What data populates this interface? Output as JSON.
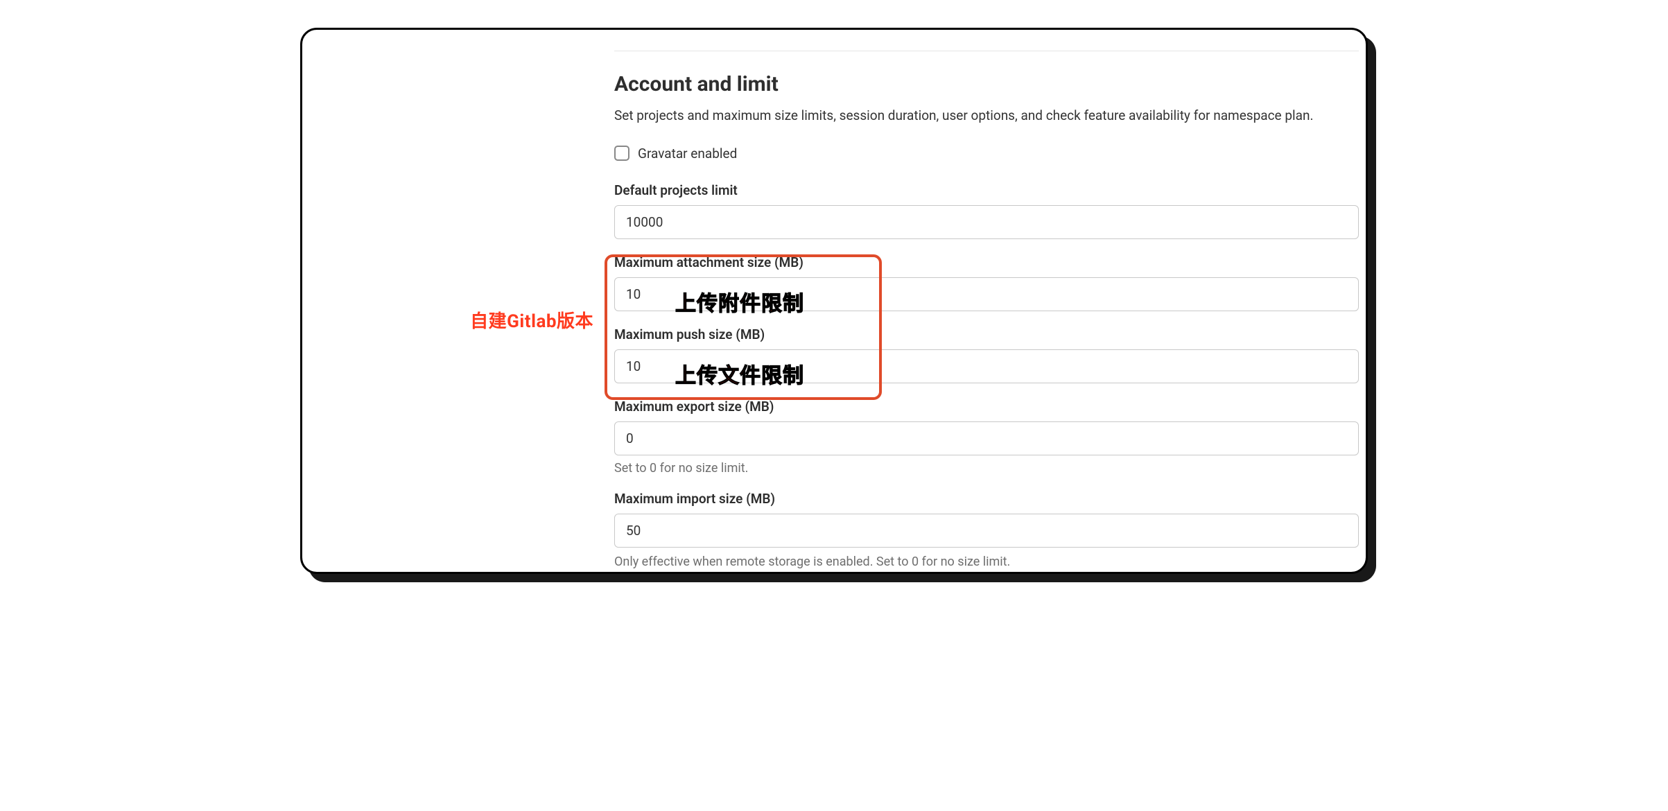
{
  "annotations": {
    "side_label": "自建Gitlab版本",
    "overlay_attachment": "上传附件限制",
    "overlay_push": "上传文件限制"
  },
  "section": {
    "title": "Account and limit",
    "description": "Set projects and maximum size limits, session duration, user options, and check feature availability for namespace plan."
  },
  "gravatar": {
    "label": "Gravatar enabled",
    "checked": false
  },
  "fields": {
    "default_projects_limit": {
      "label": "Default projects limit",
      "value": "10000"
    },
    "max_attachment_size": {
      "label": "Maximum attachment size (MB)",
      "value": "10"
    },
    "max_push_size": {
      "label": "Maximum push size (MB)",
      "value": "10"
    },
    "max_export_size": {
      "label": "Maximum export size (MB)",
      "value": "0",
      "help": "Set to 0 for no size limit."
    },
    "max_import_size": {
      "label": "Maximum import size (MB)",
      "value": "50",
      "help": "Only effective when remote storage is enabled. Set to 0 for no size limit."
    }
  }
}
